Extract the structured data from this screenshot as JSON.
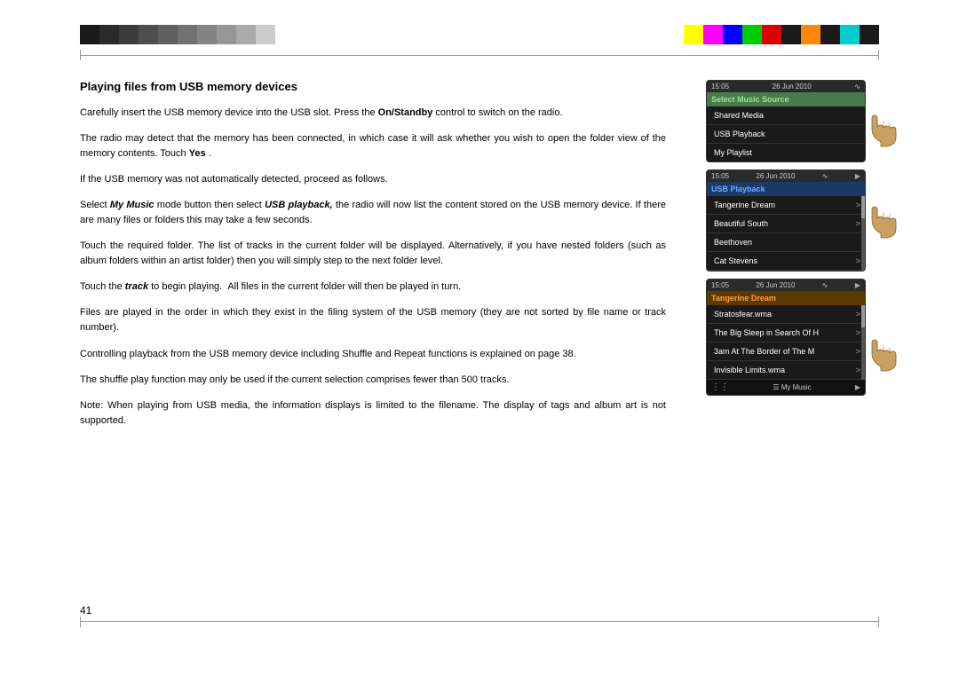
{
  "colors": {
    "top_left_blocks": [
      "#1a1a1a",
      "#2a2a2a",
      "#3a3a3a",
      "#4a4a4a",
      "#5a5a5a",
      "#6a6a6a",
      "#7a7a7a",
      "#888",
      "#aaa",
      "#ccc"
    ],
    "top_right_blocks": [
      "#ffff00",
      "#ff00ff",
      "#0000ff",
      "#00ff00",
      "#ff0000",
      "#1a1a1a",
      "#ff8800",
      "#00ffff",
      "#1a1a1a",
      "#00aaff"
    ]
  },
  "page_number": "41",
  "section_title": "Playing files from USB memory devices",
  "paragraphs": [
    "Carefully insert the USB memory device into the USB slot. Press the On/Standby control to switch on the radio.",
    "The radio may detect that the memory has been connected, in which case it will ask whether you wish to open the folder view of the memory contents. Touch Yes .",
    "If the USB memory was not automatically detected, proceed as follows.",
    "Select My Music mode button then select USB playback, the radio will now list the content stored on the USB memory device. If there are many files or folders this may take a few seconds.",
    "Touch the required folder. The list of tracks in the current folder will be displayed. Alternatively, if you have nested folders (such as album folders within an artist folder) then you will simply step to the next folder level.",
    "Touch the track to begin playing. All files in the current folder will then be played in turn.",
    "Files are played in the order in which they exist in the filing system of the USB memory (they are not sorted by file name or track number).",
    "Controlling playback from the USB memory device including Shuffle and Repeat functions is explained on page 38.",
    "The shuffle play function may only be used if the current selection comprises fewer than 500 tracks.",
    "Note: When playing from USB media, the information displays is limited to the filename. The display of tags and album art is not supported."
  ],
  "screen1": {
    "time": "15:05",
    "date": "26 Jun 2010",
    "title": "Select Music Source",
    "title_color": "green",
    "items": [
      "Shared Media",
      "USB Playback",
      "My Playlist"
    ]
  },
  "screen2": {
    "time": "15:05",
    "date": "26 Jun 2010",
    "title": "USB Playback",
    "title_color": "blue",
    "items": [
      "Tangerine Dream",
      "Beautiful South",
      "Beethoven",
      "Cat Stevens"
    ]
  },
  "screen3": {
    "time": "15:05",
    "date": "26 Jun 2010",
    "title": "Tangerine Dream",
    "title_color": "orange",
    "items": [
      "Stratosfear.wma",
      "The Big Sleep in Search Of H",
      "3am At The Border of The M",
      "Invisible Limits.wma"
    ],
    "bottom_bar": "My Music"
  }
}
